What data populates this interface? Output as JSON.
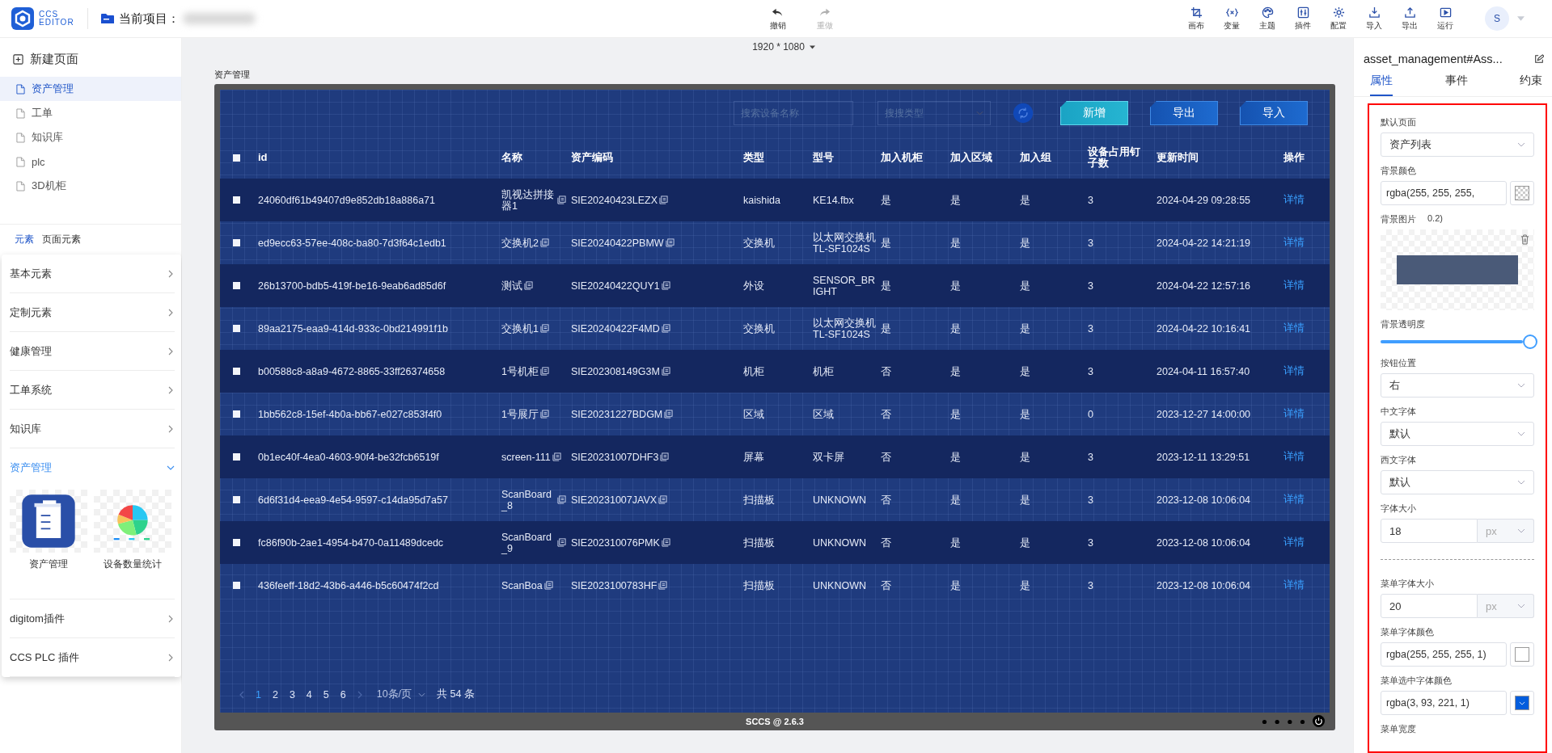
{
  "header": {
    "logo_top": "CCS",
    "logo_bottom": "EDITOR",
    "project_label": "当前项目：",
    "history": [
      {
        "label": "撤销",
        "disabled": false
      },
      {
        "label": "重做",
        "disabled": true
      }
    ],
    "tools": [
      "画布",
      "变量",
      "主题",
      "插件",
      "配置",
      "导入",
      "导出",
      "运行"
    ],
    "avatar": "S"
  },
  "left": {
    "new_page": "新建页面",
    "pages": [
      {
        "label": "资产管理",
        "selected": true
      },
      {
        "label": "工单",
        "selected": false
      },
      {
        "label": "知识库",
        "selected": false
      },
      {
        "label": "plc",
        "selected": false
      },
      {
        "label": "3D机柜",
        "selected": false
      }
    ],
    "tabs": [
      {
        "label": "元素",
        "selected": true
      },
      {
        "label": "页面元素",
        "selected": false
      }
    ],
    "groups": [
      {
        "label": "基本元素",
        "expanded": false
      },
      {
        "label": "定制元素",
        "expanded": false
      },
      {
        "label": "健康管理",
        "expanded": false
      },
      {
        "label": "工单系统",
        "expanded": false
      },
      {
        "label": "知识库",
        "expanded": false
      },
      {
        "label": "资产管理",
        "expanded": true,
        "items": [
          {
            "label": "资产管理",
            "kind": "cabinet"
          },
          {
            "label": "设备数量统计",
            "kind": "pie"
          }
        ]
      },
      {
        "label": "digitom插件",
        "expanded": false
      },
      {
        "label": "CCS PLC 插件",
        "expanded": false
      }
    ]
  },
  "canvas": {
    "resolution": "1920 * 1080",
    "page_title": "资产管理",
    "search_placeholder": "搜索设备名称",
    "type_placeholder": "搜搜类型",
    "buttons": [
      {
        "label": "新增",
        "kind": "primary"
      },
      {
        "label": "导出",
        "kind": "secondary"
      },
      {
        "label": "导入",
        "kind": "secondary"
      }
    ],
    "table": {
      "header_checked": false,
      "columns": [
        "id",
        "名称",
        "资产编码",
        "类型",
        "型号",
        "加入机柜",
        "加入区域",
        "加入组",
        "设备占用钉子数",
        "更新时间",
        "操作"
      ],
      "rows": [
        {
          "checked": false,
          "id": "24060df61b49407d9e852db18a886a71",
          "name": "凯视达拼接器1",
          "code": "SIE20240423LEZX",
          "type": "kaishida",
          "model": "KE14.fbx",
          "cabinet": "是",
          "area": "是",
          "group": "是",
          "nails": "3",
          "time": "2024-04-29 09:28:55",
          "action": "详情"
        },
        {
          "checked": false,
          "id": "ed9ecc63-57ee-408c-ba80-7d3f64c1edb1",
          "name": "交换机2",
          "code": "SIE20240422PBMW",
          "type": "交换机",
          "model": "以太网交换机TL-SF1024S",
          "cabinet": "是",
          "area": "是",
          "group": "是",
          "nails": "3",
          "time": "2024-04-22 14:21:19",
          "action": "详情"
        },
        {
          "checked": false,
          "id": "26b13700-bdb5-419f-be16-9eab6ad85d6f",
          "name": "测试",
          "code": "SIE20240422QUY1",
          "type": "外设",
          "model": "SENSOR_BRIGHT",
          "cabinet": "是",
          "area": "是",
          "group": "是",
          "nails": "3",
          "time": "2024-04-22 12:57:16",
          "action": "详情"
        },
        {
          "checked": false,
          "id": "89aa2175-eaa9-414d-933c-0bd214991f1b",
          "name": "交换机1",
          "code": "SIE20240422F4MD",
          "type": "交换机",
          "model": "以太网交换机TL-SF1024S",
          "cabinet": "是",
          "area": "是",
          "group": "是",
          "nails": "3",
          "time": "2024-04-22 10:16:41",
          "action": "详情"
        },
        {
          "checked": false,
          "id": "b00588c8-a8a9-4672-8865-33ff26374658",
          "name": "1号机柜",
          "code": "SIE202308149G3M",
          "type": "机柜",
          "model": "机柜",
          "cabinet": "否",
          "area": "是",
          "group": "是",
          "nails": "3",
          "time": "2024-04-11 16:57:40",
          "action": "详情"
        },
        {
          "checked": false,
          "id": "1bb562c8-15ef-4b0a-bb67-e027c853f4f0",
          "name": "1号展厅",
          "code": "SIE20231227BDGM",
          "type": "区域",
          "model": "区域",
          "cabinet": "否",
          "area": "是",
          "group": "是",
          "nails": "0",
          "time": "2023-12-27 14:00:00",
          "action": "详情"
        },
        {
          "checked": false,
          "id": "0b1ec40f-4ea0-4603-90f4-be32fcb6519f",
          "name": "screen-111",
          "code": "SIE20231007DHF3",
          "type": "屏幕",
          "model": "双卡屏",
          "cabinet": "否",
          "area": "是",
          "group": "是",
          "nails": "3",
          "time": "2023-12-11 13:29:51",
          "action": "详情"
        },
        {
          "checked": false,
          "id": "6d6f31d4-eea9-4e54-9597-c14da95d7a57",
          "name": "ScanBoard_8",
          "code": "SIE20231007JAVX",
          "type": "扫描板",
          "model": "UNKNOWN",
          "cabinet": "否",
          "area": "是",
          "group": "是",
          "nails": "3",
          "time": "2023-12-08 10:06:04",
          "action": "详情"
        },
        {
          "checked": false,
          "id": "fc86f90b-2ae1-4954-b470-0a11489dcedc",
          "name": "ScanBoard_9",
          "code": "SIE202310076PMK",
          "type": "扫描板",
          "model": "UNKNOWN",
          "cabinet": "否",
          "area": "是",
          "group": "是",
          "nails": "3",
          "time": "2023-12-08 10:06:04",
          "action": "详情"
        },
        {
          "checked": false,
          "id": "436feeff-18d2-43b6-a446-b5c60474f2cd",
          "name": "ScanBoa",
          "code": "SIE2023100783HF",
          "type": "扫描板",
          "model": "UNKNOWN",
          "cabinet": "否",
          "area": "是",
          "group": "是",
          "nails": "3",
          "time": "2023-12-08 10:06:04",
          "action": "详情"
        }
      ]
    },
    "pagination": {
      "pages": [
        {
          "label": "1",
          "selected": true
        },
        {
          "label": "2",
          "selected": false
        },
        {
          "label": "3",
          "selected": false
        },
        {
          "label": "4",
          "selected": false
        },
        {
          "label": "5",
          "selected": false
        },
        {
          "label": "6",
          "selected": false
        }
      ],
      "page_size": "10条/页",
      "total": "共 54 条"
    },
    "footer": "SCCS @ 2.6.3"
  },
  "panel": {
    "title": "asset_management#Ass...",
    "tabs": [
      {
        "label": "属性",
        "selected": true
      },
      {
        "label": "事件",
        "selected": false
      },
      {
        "label": "约束",
        "selected": false
      }
    ],
    "fields": [
      {
        "kind": "select",
        "label": "默认页面",
        "value": "资产列表"
      },
      {
        "kind": "color",
        "label": "背景颜色",
        "value": "rgba(255, 255, 255,"
      },
      {
        "kind": "image",
        "label": "背景图片",
        "overflow_text": "0.2)"
      },
      {
        "kind": "slider",
        "label": "背景透明度",
        "level": 1
      },
      {
        "kind": "select",
        "label": "按钮位置",
        "value": "右"
      },
      {
        "kind": "select",
        "label": "中文字体",
        "value": "默认"
      },
      {
        "kind": "select",
        "label": "西文字体",
        "value": "默认"
      },
      {
        "kind": "size",
        "label": "字体大小",
        "value": "18",
        "unit": "px"
      },
      {
        "kind": "divider"
      },
      {
        "kind": "size",
        "label": "菜单字体大小",
        "value": "20",
        "unit": "px"
      },
      {
        "kind": "color",
        "label": "菜单字体颜色",
        "value": "rgba(255, 255, 255, 1)",
        "color": "#ffffff"
      },
      {
        "kind": "color",
        "label": "菜单选中字体颜色",
        "value": "rgba(3, 93, 221, 1)",
        "color": "#035ddd"
      },
      {
        "kind": "label",
        "label": "菜单宽度"
      }
    ]
  }
}
